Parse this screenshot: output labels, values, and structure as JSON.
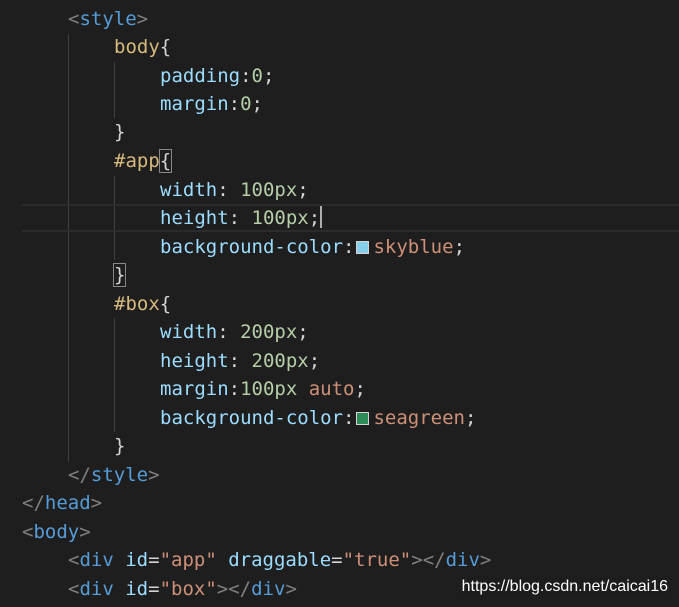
{
  "editor": {
    "colors": {
      "background": "#1e1e1e",
      "tag": "#569cd6",
      "selector": "#d7ba7d",
      "property": "#9cdcfe",
      "number": "#b5cea8",
      "string": "#ce9178"
    },
    "swatches": {
      "skyblue": "#87ceeb",
      "seagreen": "#2e8b57"
    },
    "lines": {
      "l1": {
        "lt": "<",
        "tag": "style",
        "gt": ">"
      },
      "l2": {
        "sel": "body",
        "brace": "{"
      },
      "l3": {
        "prop": "padding",
        "colon": ":",
        "num": "0",
        "semi": ";"
      },
      "l4": {
        "prop": "margin",
        "colon": ":",
        "num": "0",
        "semi": ";"
      },
      "l5": {
        "brace": "}"
      },
      "l6": {
        "sel": "#app",
        "brace": "{"
      },
      "l7": {
        "prop": "width",
        "colon": ": ",
        "num": "100px",
        "semi": ";"
      },
      "l8": {
        "prop": "height",
        "colon": ": ",
        "num": "100px",
        "semi": ";"
      },
      "l9": {
        "prop": "background-color",
        "colon": ":",
        "val": "skyblue",
        "semi": ";"
      },
      "l10": {
        "brace": "}"
      },
      "l11": {
        "sel": "#box",
        "brace": "{"
      },
      "l12": {
        "prop": "width",
        "colon": ": ",
        "num": "200px",
        "semi": ";"
      },
      "l13": {
        "prop": "height",
        "colon": ": ",
        "num": "200px",
        "semi": ";"
      },
      "l14": {
        "prop": "margin",
        "colon": ":",
        "num": "100px",
        "val": " auto",
        "semi": ";"
      },
      "l15": {
        "prop": "background-color",
        "colon": ":",
        "val": "seagreen",
        "semi": ";"
      },
      "l16": {
        "brace": "}"
      },
      "l17": {
        "lt": "</",
        "tag": "style",
        "gt": ">"
      },
      "l18": {
        "lt": "</",
        "tag": "head",
        "gt": ">"
      },
      "l19": {
        "lt": "<",
        "tag": "body",
        "gt": ">"
      },
      "l20": {
        "lt": "<",
        "tag": "div",
        "attr1": " id",
        "eq1": "=",
        "str1": "\"app\"",
        "attr2": " draggable",
        "eq2": "=",
        "str2": "\"true\"",
        "gt": ">",
        "close_lt": "</",
        "close_tag": "div",
        "close_gt": ">"
      },
      "l21": {
        "lt": "<",
        "tag": "div",
        "attr1": " id",
        "eq1": "=",
        "str1": "\"box\"",
        "gt": ">",
        "close_lt": "</",
        "close_tag": "div",
        "close_gt": ">"
      }
    }
  },
  "watermark": "https://blog.csdn.net/caicai16"
}
